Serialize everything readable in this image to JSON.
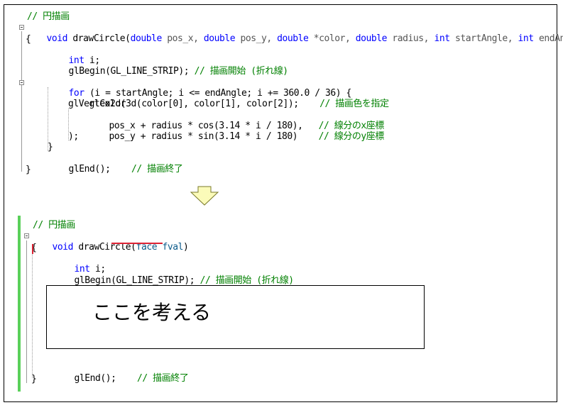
{
  "top_code": {
    "comment_title": "// 円描画",
    "sig_void": "void",
    "sig_name": " drawCircle(",
    "sig_params": [
      {
        "type": "double",
        "name": " pos_x, "
      },
      {
        "type": "double",
        "name": " pos_y, "
      },
      {
        "type": "double",
        "name": " *color, "
      },
      {
        "type": "double",
        "name": " radius, "
      },
      {
        "type": "int",
        "name": " startAngle, "
      },
      {
        "type": "int",
        "name": " endAngle)"
      }
    ],
    "open_brace": "{",
    "decl_kw": "int",
    "decl_rest": " i;",
    "begin_call": "glBegin(GL_LINE_STRIP); ",
    "begin_comment": "// 描画開始 (折れ線)",
    "for_kw": "for",
    "for_rest": " (i = startAngle; i <= endAngle; i += 360.0 / 36) {",
    "color_call": "glColor3d(color[0], color[1], color[2]);    ",
    "color_comment": "// 描画色を指定",
    "vertex_call": "glVertex2d(",
    "vx_expr": "pos_x + radius * cos(3.14 * i / 180),   ",
    "vx_comment": "// 線分のx座標",
    "vy_expr": "pos_y + radius * sin(3.14 * i / 180)    ",
    "vy_comment": "// 線分のy座標",
    "vertex_close": ");",
    "for_close": "}",
    "end_call": "glEnd();    ",
    "end_comment": "// 描画終了",
    "close_brace": "}"
  },
  "bottom_code": {
    "comment_title": "// 円描画",
    "sig_void": "void",
    "sig_name": " drawCircle(",
    "sig_params_text": "face fval",
    "sig_close": ")",
    "open_brace": "{",
    "decl_kw": "int",
    "decl_rest": " i;",
    "begin_call": "glBegin(GL_LINE_STRIP); ",
    "begin_comment": "// 描画開始 (折れ線)",
    "placeholder_text": "ここを考える",
    "end_call": "glEnd();    ",
    "end_comment": "// 描画終了",
    "close_brace": "}"
  },
  "colors": {
    "keyword": "#0000ff",
    "comment": "#008000",
    "change_bar": "#5ad05a",
    "arrow_fill": "#fbfbb9",
    "squiggle": "#d23"
  },
  "icons": {
    "fold": "collapse-minus-icon",
    "arrow": "down-arrow-icon"
  }
}
